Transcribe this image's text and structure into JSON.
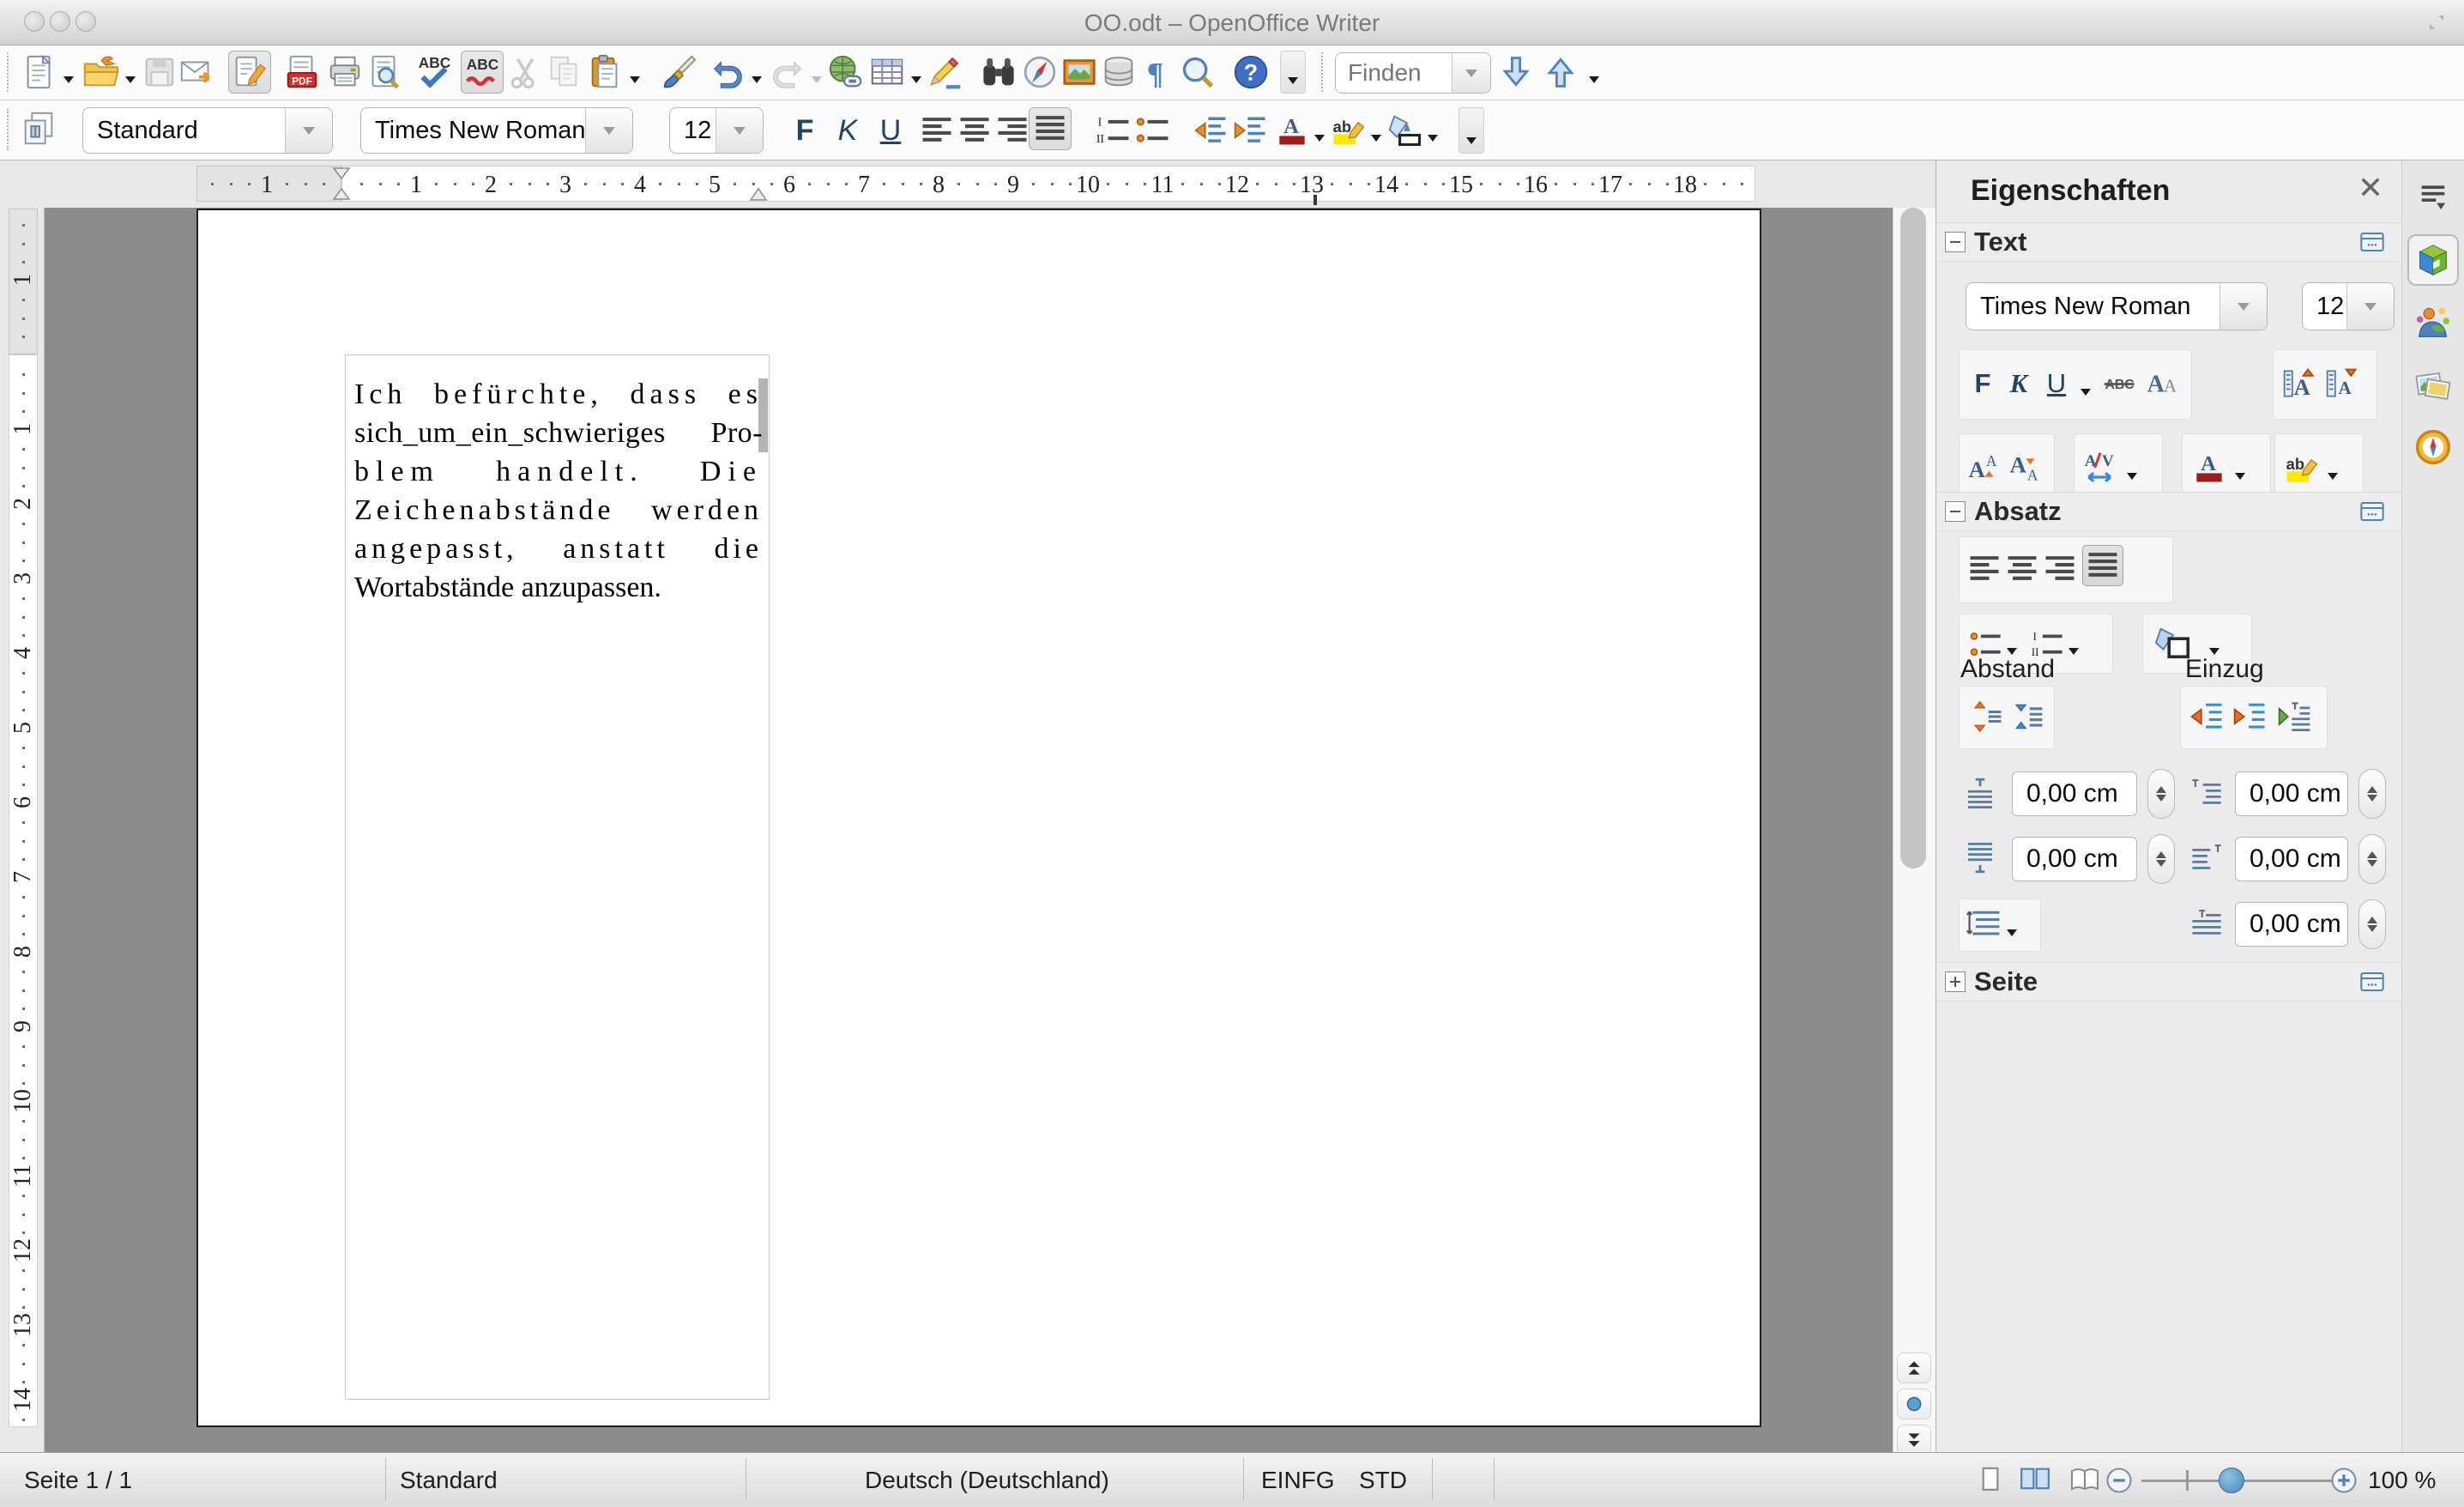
{
  "window": {
    "title": "OO.odt – OpenOffice Writer",
    "controls": [
      {
        "name": "close-button"
      },
      {
        "name": "minimize-button"
      },
      {
        "name": "zoom-button"
      }
    ]
  },
  "toolbar_standard": {
    "items": [
      {
        "name": "new-document",
        "icon": "new-doc",
        "dropdown": true
      },
      {
        "name": "open",
        "icon": "open-folder",
        "dropdown": true
      },
      {
        "name": "save",
        "icon": "save-disabled",
        "disabled": true
      },
      {
        "name": "email-document",
        "icon": "email"
      },
      {
        "name": "edit-file",
        "icon": "edit-file",
        "active": true
      },
      {
        "name": "export-pdf",
        "icon": "pdf"
      },
      {
        "name": "print",
        "icon": "printer"
      },
      {
        "name": "page-preview",
        "icon": "preview"
      },
      {
        "name": "spelling",
        "icon": "spellcheck"
      },
      {
        "name": "auto-spellcheck",
        "icon": "autospell",
        "active": true
      },
      {
        "name": "cut",
        "icon": "cut-disabled",
        "disabled": true
      },
      {
        "name": "copy",
        "icon": "copy-disabled",
        "disabled": true
      },
      {
        "name": "paste",
        "icon": "paste",
        "dropdown": true
      },
      {
        "name": "format-paintbrush",
        "icon": "brush"
      },
      {
        "name": "undo",
        "icon": "undo",
        "dropdown": true
      },
      {
        "name": "redo",
        "icon": "redo-disabled",
        "disabled": true,
        "dropdown": true,
        "dropdown_disabled": true
      },
      {
        "name": "hyperlink",
        "icon": "hyperlink"
      },
      {
        "name": "insert-table",
        "icon": "table",
        "dropdown": true
      },
      {
        "name": "draw-functions",
        "icon": "draw"
      },
      {
        "name": "find-replace",
        "icon": "binoculars"
      },
      {
        "name": "navigator",
        "icon": "compass"
      },
      {
        "name": "gallery",
        "icon": "gallery"
      },
      {
        "name": "data-sources",
        "icon": "datasource"
      },
      {
        "name": "formatting-marks",
        "icon": "pilcrow"
      },
      {
        "name": "zoom",
        "icon": "zoomglass"
      },
      {
        "name": "help",
        "icon": "help"
      }
    ]
  },
  "find": {
    "placeholder": "Finden"
  },
  "toolbar_formatting": {
    "style": "Standard",
    "font": "Times New Roman",
    "size": "12",
    "buttons": [
      {
        "name": "bold",
        "label": "F"
      },
      {
        "name": "italic",
        "label": "K"
      },
      {
        "name": "underline",
        "label": "U"
      }
    ]
  },
  "rulers": {
    "horizontal": {
      "margin_numbers": [
        "1"
      ],
      "numbers": [
        "1",
        "2",
        "3",
        "4",
        "5",
        "6",
        "7",
        "8",
        "9",
        "10",
        "11",
        "12",
        "13",
        "14",
        "15",
        "16",
        "17",
        "18"
      ]
    },
    "vertical": {
      "margin_numbers": [
        "1"
      ],
      "numbers": [
        "1",
        "2",
        "3",
        "4",
        "5",
        "6",
        "7",
        "8",
        "9",
        "10",
        "11",
        "12",
        "13",
        "14"
      ]
    }
  },
  "document": {
    "lines": [
      {
        "text": "Ich befürchte, dass es"
      },
      {
        "text": "sich_um_ein_schwieriges Pro-"
      },
      {
        "text": "blem handelt. Die"
      },
      {
        "text": "Zeichenabstände werden"
      },
      {
        "text": "angepasst, anstatt die"
      },
      {
        "text": "Wortabstände anzupassen."
      }
    ]
  },
  "sidebar": {
    "title": "Eigenschaften",
    "text_section": {
      "title": "Text",
      "font_name": "Times New Roman",
      "font_size": "12",
      "bold_label": "F",
      "italic_label": "K",
      "underline_label": "U"
    },
    "paragraph_section": {
      "title": "Absatz",
      "spacing_label": "Abstand",
      "indent_label": "Einzug",
      "spacing_above": "0,00 cm",
      "spacing_below": "0,00 cm",
      "indent_before": "0,00 cm",
      "indent_after": "0,00 cm",
      "first_line_indent": "0,00 cm"
    },
    "page_section": {
      "title": "Seite"
    },
    "tabs": [
      {
        "name": "tab-properties",
        "selected": true
      },
      {
        "name": "tab-styles"
      },
      {
        "name": "tab-gallery"
      },
      {
        "name": "tab-navigator"
      }
    ]
  },
  "statusbar": {
    "page": "Seite 1 / 1",
    "style": "Standard",
    "language": "Deutsch (Deutschland)",
    "insert_mode": "EINFG",
    "selection_mode": "STD",
    "zoom_level": "100 %"
  }
}
